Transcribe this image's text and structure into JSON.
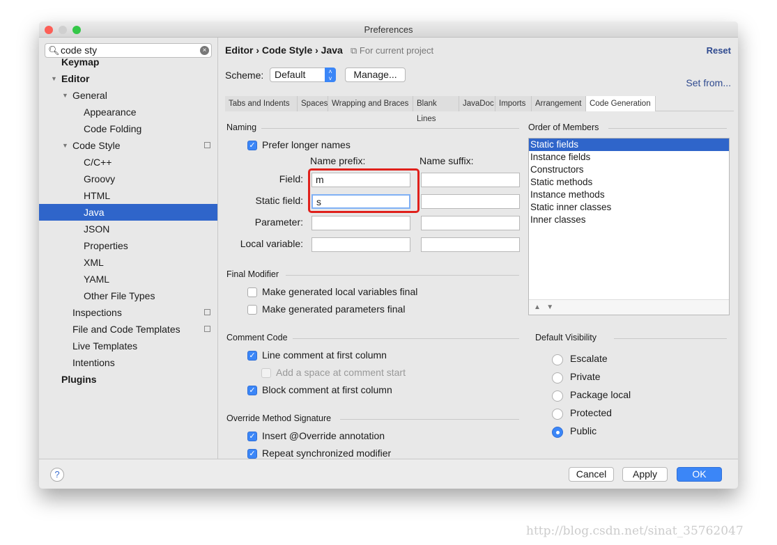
{
  "window": {
    "title": "Preferences"
  },
  "search": {
    "value": "code sty"
  },
  "sidebar": {
    "items": [
      {
        "label": "Keymap",
        "level": 0,
        "bold": true
      },
      {
        "label": "Editor",
        "level": 0,
        "bold": true,
        "expanded": true
      },
      {
        "label": "General",
        "level": 1,
        "expanded": true
      },
      {
        "label": "Appearance",
        "level": 2
      },
      {
        "label": "Code Folding",
        "level": 2
      },
      {
        "label": "Code Style",
        "level": 1,
        "expanded": true,
        "project": true
      },
      {
        "label": "C/C++",
        "level": 2
      },
      {
        "label": "Groovy",
        "level": 2
      },
      {
        "label": "HTML",
        "level": 2
      },
      {
        "label": "Java",
        "level": 2,
        "selected": true
      },
      {
        "label": "JSON",
        "level": 2
      },
      {
        "label": "Properties",
        "level": 2
      },
      {
        "label": "XML",
        "level": 2
      },
      {
        "label": "YAML",
        "level": 2
      },
      {
        "label": "Other File Types",
        "level": 2
      },
      {
        "label": "Inspections",
        "level": 1,
        "project": true
      },
      {
        "label": "File and Code Templates",
        "level": 1,
        "project": true
      },
      {
        "label": "Live Templates",
        "level": 1
      },
      {
        "label": "Intentions",
        "level": 1
      },
      {
        "label": "Plugins",
        "level": 0,
        "bold": true
      }
    ]
  },
  "header": {
    "breadcrumb": "Editor › Code Style › Java",
    "scope": "For current project",
    "reset": "Reset"
  },
  "scheme": {
    "label": "Scheme:",
    "value": "Default",
    "manage": "Manage...",
    "set_from": "Set from..."
  },
  "tabs": [
    "Tabs and Indents",
    "Spaces",
    "Wrapping and Braces",
    "Blank Lines",
    "JavaDoc",
    "Imports",
    "Arrangement",
    "Code Generation"
  ],
  "active_tab": "Code Generation",
  "naming": {
    "title": "Naming",
    "prefer_longer": "Prefer longer names",
    "prefix_header": "Name prefix:",
    "suffix_header": "Name suffix:",
    "rows": [
      {
        "label": "Field:",
        "prefix": "m",
        "suffix": ""
      },
      {
        "label": "Static field:",
        "prefix": "s",
        "suffix": ""
      },
      {
        "label": "Parameter:",
        "prefix": "",
        "suffix": ""
      },
      {
        "label": "Local variable:",
        "prefix": "",
        "suffix": ""
      }
    ]
  },
  "final_modifier": {
    "title": "Final Modifier",
    "local": "Make generated local variables final",
    "params": "Make generated parameters final"
  },
  "comment_code": {
    "title": "Comment Code",
    "line": "Line comment at first column",
    "space": "Add a space at comment start",
    "block": "Block comment at first column"
  },
  "override": {
    "title": "Override Method Signature",
    "insert": "Insert @Override annotation",
    "repeat": "Repeat synchronized modifier"
  },
  "order": {
    "title": "Order of Members",
    "items": [
      "Static fields",
      "Instance fields",
      "Constructors",
      "Static methods",
      "Instance methods",
      "Static inner classes",
      "Inner classes"
    ]
  },
  "visibility": {
    "title": "Default Visibility",
    "options": [
      "Escalate",
      "Private",
      "Package local",
      "Protected",
      "Public"
    ],
    "selected": "Public"
  },
  "footer": {
    "help": "?",
    "cancel": "Cancel",
    "apply": "Apply",
    "ok": "OK"
  },
  "watermark": "http://blog.csdn.net/sinat_35762047",
  "colors": {
    "accent": "#3b86f7",
    "selection": "#2f65ca",
    "highlight": "#e0201b"
  }
}
